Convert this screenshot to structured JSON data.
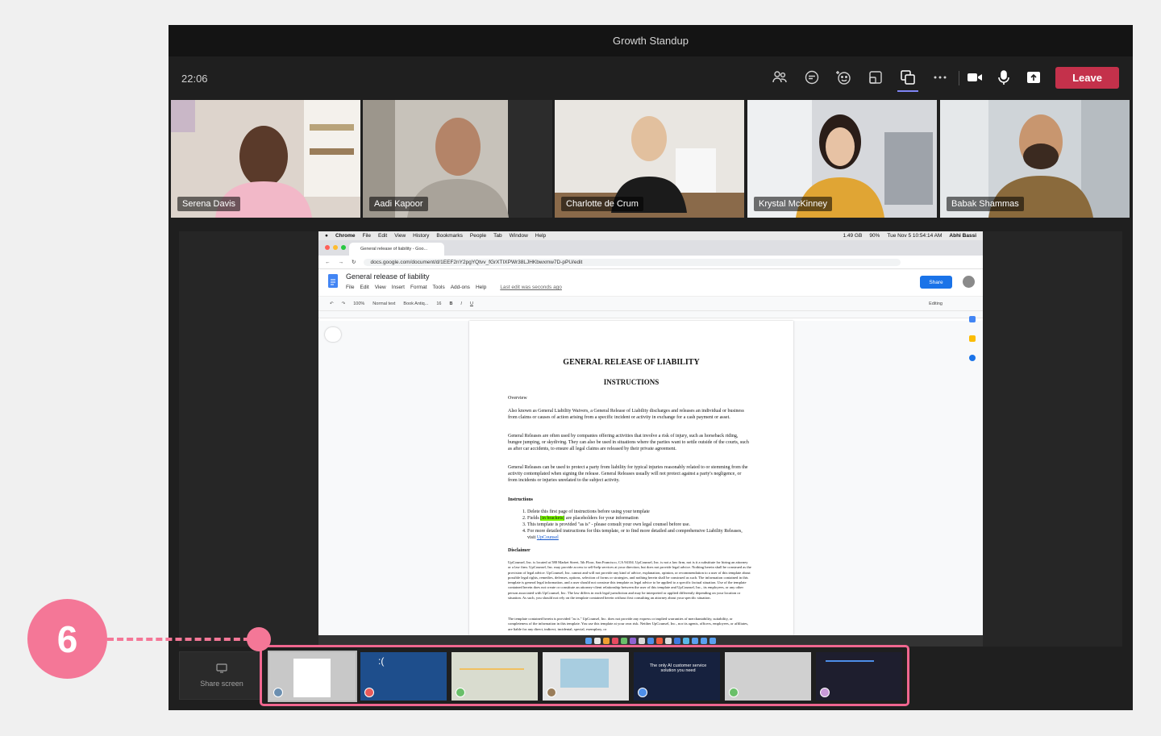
{
  "window": {
    "title": "Growth Standup"
  },
  "toolbar": {
    "clock": "22:06",
    "leave_label": "Leave"
  },
  "participants": [
    {
      "name": "Serena Davis"
    },
    {
      "name": "Aadi Kapoor"
    },
    {
      "name": "Charlotte de Crum"
    },
    {
      "name": "Krystal McKinney"
    },
    {
      "name": "Babak Shammas"
    }
  ],
  "screen": {
    "macmenu": {
      "app": "Chrome",
      "items": [
        "File",
        "Edit",
        "View",
        "History",
        "Bookmarks",
        "People",
        "Tab",
        "Window",
        "Help"
      ],
      "storage": "1.49 GB",
      "battery": "90%",
      "datetime": "Tue Nov 5  10:54:14 AM",
      "user": "Abhi Bassi"
    },
    "browser": {
      "tab_title": "General release of liability - Goo...",
      "url": "docs.google.com/document/d/1EEF2nY2pgYQtvv_fGrXTIXPWr38LJHKbwxmw7D-pPU/edit"
    },
    "doc": {
      "title": "General release of liability",
      "menu": [
        "File",
        "Edit",
        "View",
        "Insert",
        "Format",
        "Tools",
        "Add-ons",
        "Help"
      ],
      "last_edit": "Last edit was seconds ago",
      "share_label": "Share",
      "zoom": "100%",
      "style": "Normal text",
      "font": "Book Antiq...",
      "size": "16",
      "mode": "Editing",
      "heading": "GENERAL RELEASE OF LIABILITY",
      "subheading": "INSTRUCTIONS",
      "overview_label": "Overview",
      "p1": "Also known as General Liability Waivers, a General Release of Liability discharges and releases an individual or business from claims or causes of action arising from a specific incident or activity in exchange for a cash payment or asset.",
      "p2": "General Releases are often used by companies offering activities that involve a risk of injury, such as horseback riding, bungee jumping, or skydiving. They can also be used in situations where the parties want to settle outside of the courts, such as after car accidents, to ensure all legal claims are released by their private agreement.",
      "p3": "General Releases can be used to protect a party from liability for typical injuries reasonably related to or stemming from the activity contemplated when signing the release. General Releases usually will not protect against a party's negligence, or from incidents or injuries unrelated to the subject activity.",
      "instructions_label": "Instructions",
      "inst1": "Delete this first page of instructions before using your template",
      "inst2_a": "Fields",
      "inst2_hl": "[in brackets]",
      "inst2_b": "are placeholders for your information",
      "inst3": "This template is provided \"as is\" - please consult your own legal counsel before use.",
      "inst4": "For more detailed instructions for this template, or to find more detailed and comprehensive Liability Releases, visit",
      "inst4_link": "UpCounsel",
      "disclaimer_label": "Disclaimer",
      "d1": "UpCounsel, Inc. is located at 580 Market Street, 5th Floor, San Francisco, CA 94104. UpCounsel, Inc. is not a law firm, not is it a substitute for hiring an attorney or a law firm. UpCounsel, Inc. may provide access to self-help services at your direction, but does not provide legal advice. Nothing herein shall be construed as the provision of legal advice. UpCounsel, Inc. cannot and will not provide any kind of advice, explanation, opinion, or recommendation to a user of this template about possible legal rights, remedies, defenses, options, selection of forms or strategies, and nothing herein shall be construed as such. The information contained in this template is general legal information, and a user should not construe this template as legal advice to be applied to a specific factual situation. Use of the template contained herein does not create or constitute an attorney-client relationship between the user of this template and UpCounsel, Inc., its employees, or any other person associated with UpCounsel, Inc. The law differs in each legal jurisdiction and may be interpreted or applied differently depending on your location or situation. As such, you should not rely on the template contained herein without first consulting an attorney about your specific situation.",
      "d2": "The template contained herein is provided \"as is.\" UpCounsel, Inc. does not provide any express or implied warranties of merchantability, suitability, or completeness of the information in this template. You use this template at your own risk. Neither UpCounsel, Inc., nor its agents, officers, employees, or affiliates, are liable for any direct, indirect, incidental, special, exemplary, or"
    }
  },
  "share_screen_label": "Share screen",
  "thumbnail_caption": "The only AI customer service solution you need",
  "callout_number": "6",
  "colors": {
    "leave": "#c4314b",
    "highlight": "#f0668f",
    "callout": "#f47797",
    "share": "#1a73e8"
  }
}
